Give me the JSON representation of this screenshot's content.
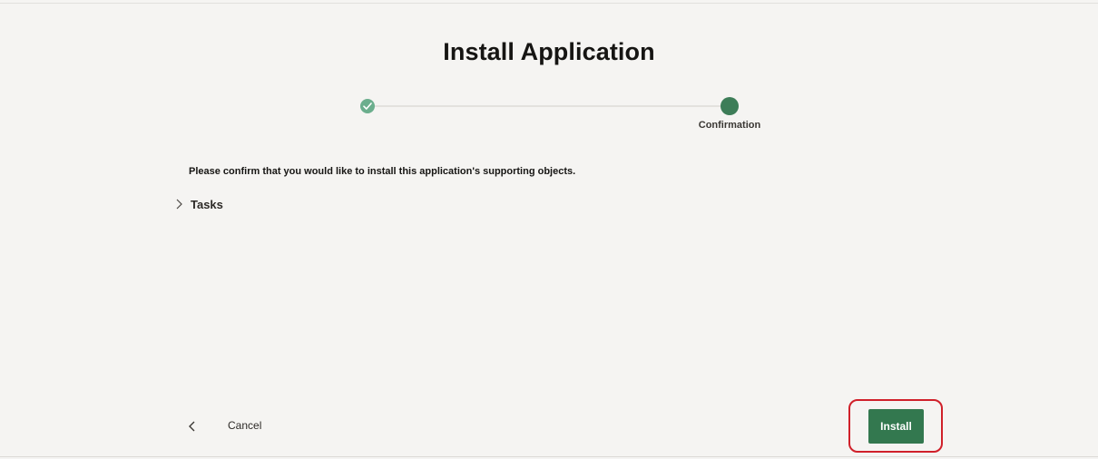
{
  "dialog": {
    "title": "Install Application"
  },
  "wizard": {
    "steps": [
      {
        "label": "",
        "state": "completed",
        "icon": "check-icon"
      },
      {
        "label": "Confirmation",
        "state": "current",
        "icon": "current-step-dot"
      }
    ]
  },
  "main": {
    "confirm_text": "Please confirm that you would like to install this application's supporting objects.",
    "tasks_label": "Tasks"
  },
  "footer": {
    "cancel_label": "Cancel",
    "install_label": "Install",
    "back_icon": "chevron-left-icon"
  },
  "colors": {
    "background": "#f5f4f2",
    "accent": "#33784f",
    "step_completed": "#6bae8d",
    "highlight": "#d0202a"
  }
}
